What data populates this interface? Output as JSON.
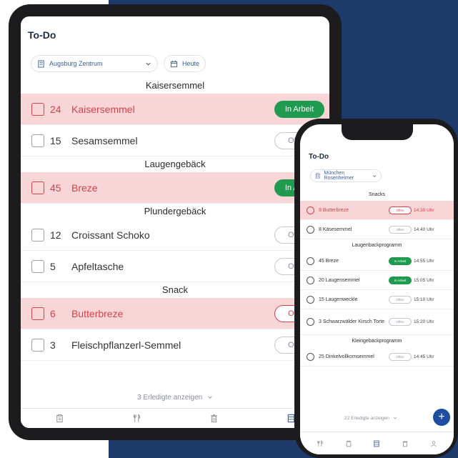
{
  "colors": {
    "background_panel": "#1d3a6b",
    "in_arbeit": "#1f9b4f",
    "open_red": "#d3424a",
    "accent": "#3a5d99",
    "fab": "#1d4ea1"
  },
  "tablet": {
    "title": "To-Do",
    "location": {
      "label": "Augsburg Zentrum",
      "icon": "building-icon"
    },
    "date_filter": {
      "label": "Heute",
      "icon": "calendar-icon"
    },
    "sections": [
      {
        "title": "Kaisersemmel",
        "rows": [
          {
            "qty": "24",
            "name": "Kaisersemmel",
            "status": "In Arbeit",
            "type": "arbeit",
            "highlight": true
          },
          {
            "qty": "15",
            "name": "Sesamsemmel",
            "status": "Offen",
            "type": "offen",
            "highlight": false
          }
        ]
      },
      {
        "title": "Laugengebäck",
        "rows": [
          {
            "qty": "45",
            "name": "Breze",
            "status": "In Arbeit",
            "type": "arbeit",
            "highlight": true
          }
        ]
      },
      {
        "title": "Plundergebäck",
        "rows": [
          {
            "qty": "12",
            "name": "Croissant Schoko",
            "status": "Offen",
            "type": "offen",
            "highlight": false
          },
          {
            "qty": "5",
            "name": "Apfeltasche",
            "status": "Offen",
            "type": "offen",
            "highlight": false
          }
        ]
      },
      {
        "title": "Snack",
        "rows": [
          {
            "qty": "6",
            "name": "Butterbreze",
            "status": "Offen",
            "type": "offen",
            "highlight": true
          },
          {
            "qty": "3",
            "name": "Fleischpflanzerl-Semmel",
            "status": "Offen",
            "type": "offen",
            "highlight": false
          }
        ]
      }
    ],
    "show_done": "3 Erledigte anzeigen",
    "tabs": [
      "clipboard-icon",
      "cutlery-icon",
      "trash-icon",
      "list-icon"
    ]
  },
  "phone": {
    "title": "To-Do",
    "location": {
      "label": "München Rosenheimer",
      "icon": "building-icon"
    },
    "sections": [
      {
        "title": "Snacks",
        "rows": [
          {
            "name": "9  Butterbreze",
            "status": "Offen",
            "type": "offen",
            "time": "14:30 Uhr",
            "highlight": true
          },
          {
            "name": "8  Käsesemmel",
            "status": "Offen",
            "type": "offen",
            "time": "14:40 Uhr",
            "highlight": false
          }
        ]
      },
      {
        "title": "Laugenbackprogramm",
        "rows": [
          {
            "name": "45  Breze",
            "status": "In Arbeit",
            "type": "arbeit",
            "time": "14:55 Uhr",
            "highlight": false
          },
          {
            "name": "20  Laugensemmel",
            "status": "In Arbeit",
            "type": "arbeit",
            "time": "15:05 Uhr",
            "highlight": false
          },
          {
            "name": "15  Laugenweckle",
            "status": "Offen",
            "type": "offen",
            "time": "15:10 Uhr",
            "highlight": false
          },
          {
            "name": "3  Schwarzwälder Kirsch Torte",
            "status": "Offen",
            "type": "offen",
            "time": "15:20 Uhr",
            "highlight": false,
            "tall": true
          }
        ]
      },
      {
        "title": "Kleingebäckprogramm",
        "rows": [
          {
            "name": "25  Dinkelvollkornsemmel",
            "status": "Offen",
            "type": "offen",
            "time": "14:45 Uhr",
            "highlight": false
          }
        ]
      }
    ],
    "show_done": "22 Erledigte anzeigen",
    "fab": "+",
    "tabs": [
      "cutlery-icon",
      "clipboard-icon",
      "list-icon",
      "trash-icon",
      "user-icon"
    ]
  }
}
